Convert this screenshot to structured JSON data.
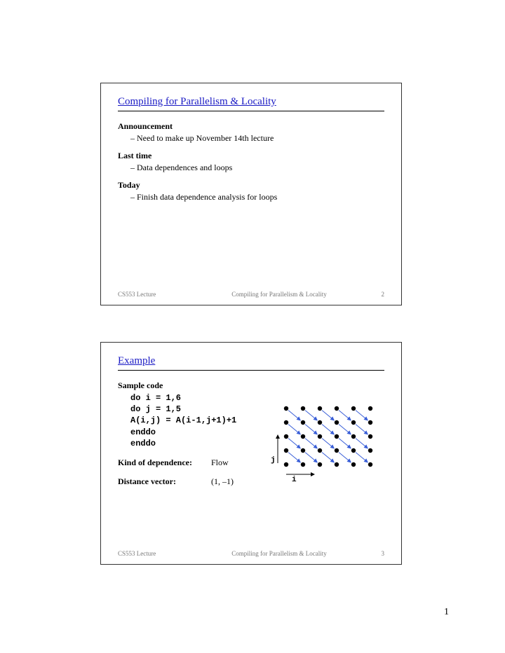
{
  "slide1": {
    "title": "Compiling for Parallelism & Locality",
    "sec1_head": "Announcement",
    "sec1_item": "Need to make up November 14th lecture",
    "sec2_head": "Last time",
    "sec2_item": "Data dependences and loops",
    "sec3_head": "Today",
    "sec3_item": "Finish data dependence analysis for loops",
    "footer_left": "CS553 Lecture",
    "footer_center": "Compiling for Parallelism & Locality",
    "footer_right": "2"
  },
  "slide2": {
    "title": "Example",
    "sec1_head": "Sample code",
    "code_l1": "do i = 1,6",
    "code_l2": "   do j = 1,5",
    "code_l3": "      A(i,j) = A(i-1,j+1)+1",
    "code_l4": "   enddo",
    "code_l5": "enddo",
    "dep_label": "Kind of dependence:",
    "dep_value": "Flow",
    "dist_label": "Distance vector:",
    "dist_value": "(1, –1)",
    "axis_i": "i",
    "axis_j": "j",
    "footer_left": "CS553 Lecture",
    "footer_center": "Compiling for Parallelism & Locality",
    "footer_right": "3"
  },
  "chart_data": {
    "type": "scatter",
    "description": "Iteration-space grid 6 columns (i=1..6) by 5 rows (j=1..5), black dots at each integer point. Blue dependence arrows of distance (1,-1): from (i,j) to (i+1,j-1). j-axis arrow points up, i-axis arrow points right.",
    "i_range": [
      1,
      6
    ],
    "j_range": [
      1,
      5
    ],
    "distance_vector": [
      1,
      -1
    ]
  },
  "page_number": "1"
}
